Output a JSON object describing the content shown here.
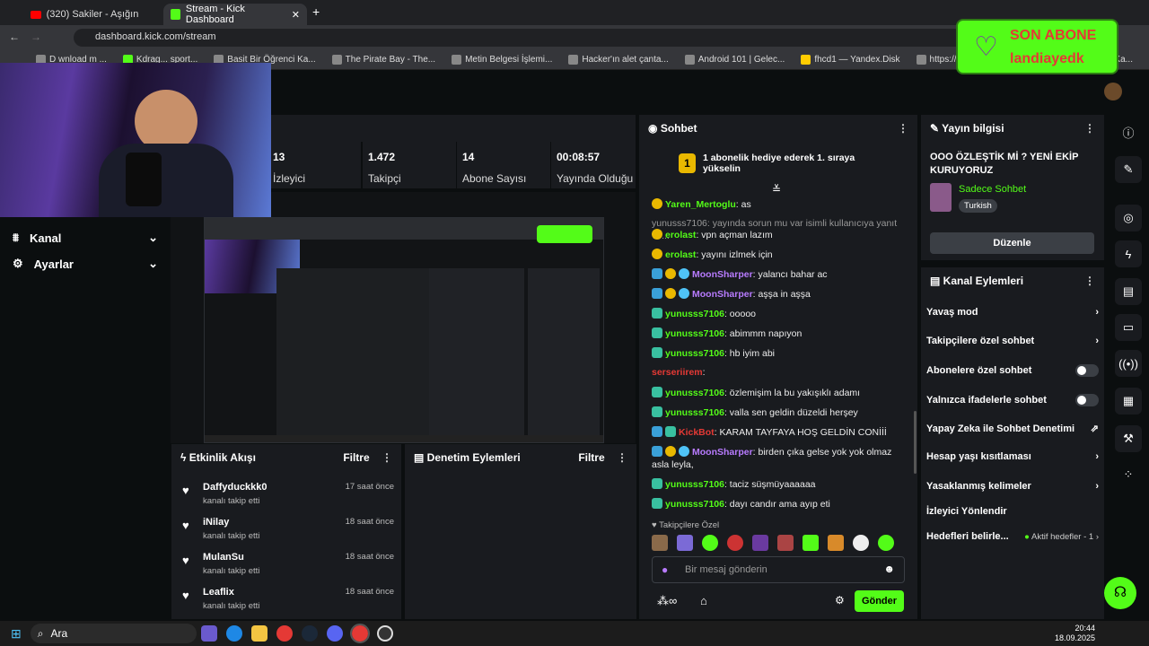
{
  "browser": {
    "tabs": [
      {
        "title": "(320) Sakiler - Aşığın Kader"
      },
      {
        "title": "Stream - Kick Dashboard"
      }
    ],
    "url": "dashboard.kick.com/stream",
    "bookmarks": [
      "D wnload m ...",
      "Kdrag... sport...",
      "Basit Bir Öğrenci Ka...",
      "The Pirate Bay - The...",
      "Metin Belgesi İşlemi...",
      "Hacker'ın alet çanta...",
      "Android 101 | Gelec...",
      "fhcd1 — Yandex.Disk",
      "https://www.google...",
      "Simge Çizmek ve Ka..."
    ]
  },
  "alert": {
    "title": "SON ABONE",
    "name": "landiayedk"
  },
  "stats": [
    {
      "value": "13",
      "label": "İzleyici"
    },
    {
      "value": "1.472",
      "label": "Takipçi"
    },
    {
      "value": "14",
      "label": "Abone Sayısı"
    },
    {
      "value": "00:08:57",
      "label": "Yayında Olduğu"
    }
  ],
  "nav": [
    {
      "label": "Kanal"
    },
    {
      "label": "Ayarlar"
    }
  ],
  "events": {
    "title": "Etkinlik Akışı",
    "filter": "Filtre",
    "items": [
      {
        "name": "Daffyduckkk0",
        "sub": "kanalı takip etti",
        "time": "17 saat önce"
      },
      {
        "name": "iNilay",
        "sub": "kanalı takip etti",
        "time": "18 saat önce"
      },
      {
        "name": "MulanSu",
        "sub": "kanalı takip etti",
        "time": "18 saat önce"
      },
      {
        "name": "Leaflix",
        "sub": "kanalı takip etti",
        "time": "18 saat önce"
      }
    ]
  },
  "moderation": {
    "title": "Denetim Eylemleri",
    "filter": "Filtre"
  },
  "chat": {
    "title": "Sohbet",
    "pinned": "1 abonelik hediye ederek 1. sıraya yükselin",
    "pinned_rank": "1",
    "messages": [
      {
        "user": "Yaren_Mertoglu",
        "text": ": as",
        "color": "#53fc18",
        "badges": [
          "gold"
        ]
      },
      {
        "user": "",
        "text": "yunusss7106: yayında sorun mu var isimli kullanıcıya yanıt ve...",
        "color": "#999999",
        "badges": []
      },
      {
        "user": "erolast",
        "text": ": vpn açman lazım",
        "color": "#53fc18",
        "badges": [
          "gold"
        ]
      },
      {
        "user": "erolast",
        "text": ": yayını izlmek için",
        "color": "#53fc18",
        "badges": [
          "gold"
        ]
      },
      {
        "user": "MoonSharper",
        "text": ": yalancı bahar ac",
        "color": "#b87bff",
        "badges": [
          "blue",
          "gold",
          "heart"
        ]
      },
      {
        "user": "MoonSharper",
        "text": ": aşşa in aşşa",
        "color": "#b87bff",
        "badges": [
          "blue",
          "gold",
          "heart"
        ]
      },
      {
        "user": "yunusss7106",
        "text": ": ooooo",
        "color": "#53fc18",
        "badges": [
          "green"
        ]
      },
      {
        "user": "yunusss7106",
        "text": ": abimmm napıyon",
        "color": "#53fc18",
        "badges": [
          "green"
        ]
      },
      {
        "user": "yunusss7106",
        "text": ": hb iyim abi",
        "color": "#53fc18",
        "badges": [
          "green"
        ]
      },
      {
        "user": "serseriirem",
        "text": ":",
        "color": "#e53935",
        "badges": []
      },
      {
        "user": "yunusss7106",
        "text": ": özlemişim la bu yakışıklı adamı",
        "color": "#53fc18",
        "badges": [
          "green"
        ]
      },
      {
        "user": "yunusss7106",
        "text": ": valla sen geldin düzeldi herşey",
        "color": "#53fc18",
        "badges": [
          "green"
        ]
      },
      {
        "user": "KickBot",
        "text": ": KARAM TAYFAYA HOŞ GELDİN CONİİİ",
        "color": "#e53935",
        "badges": [
          "blue",
          "green"
        ]
      },
      {
        "user": "MoonSharper",
        "text": ": birden çıka gelse yok yok olmaz asla leyla,",
        "color": "#b87bff",
        "badges": [
          "blue",
          "gold",
          "heart"
        ]
      },
      {
        "user": "yunusss7106",
        "text": ": taciz süşmüyaaaaaa",
        "color": "#53fc18",
        "badges": [
          "green"
        ]
      },
      {
        "user": "yunusss7106",
        "text": ": dayı candır ama ayıp eti",
        "color": "#53fc18",
        "badges": [
          "green"
        ]
      }
    ],
    "followers_only": "Takipçilere Özel",
    "input_placeholder": "Bir mesaj gönderin",
    "send_label": "Gönder"
  },
  "stream_info": {
    "title": "Yayın bilgisi",
    "stream_title": "OOO ÖZLEŞTİK Mİ ? YENİ EKİP KURUYORUZ",
    "category": "Sadece Sohbet",
    "language": "Turkish",
    "edit_label": "Düzenle"
  },
  "channel_actions": {
    "title": "Kanal Eylemleri",
    "items": [
      {
        "label": "Yavaş mod",
        "control": "chevron"
      },
      {
        "label": "Takipçilere özel sohbet",
        "control": "chevron"
      },
      {
        "label": "Abonelere özel sohbet",
        "control": "toggle"
      },
      {
        "label": "Yalnızca ifadelerle sohbet",
        "control": "toggle"
      },
      {
        "label": "Yapay Zeka ile Sohbet Denetimi",
        "control": "external"
      },
      {
        "label": "Hesap yaşı kısıtlaması",
        "control": "chevron"
      },
      {
        "label": "Yasaklanmış kelimeler",
        "control": "chevron"
      },
      {
        "label": "İzleyici Yönlendir",
        "control": "none"
      },
      {
        "label": "Hedefleri belirle...",
        "control": "chevron",
        "extra": "Aktif hedefler - 1"
      }
    ]
  },
  "taskbar": {
    "search": "Ara",
    "time": "20:44",
    "date": "18.09.2025"
  },
  "colors": {
    "accent": "#53fc18",
    "panel": "#191b1f",
    "background": "#0b0e0f"
  }
}
